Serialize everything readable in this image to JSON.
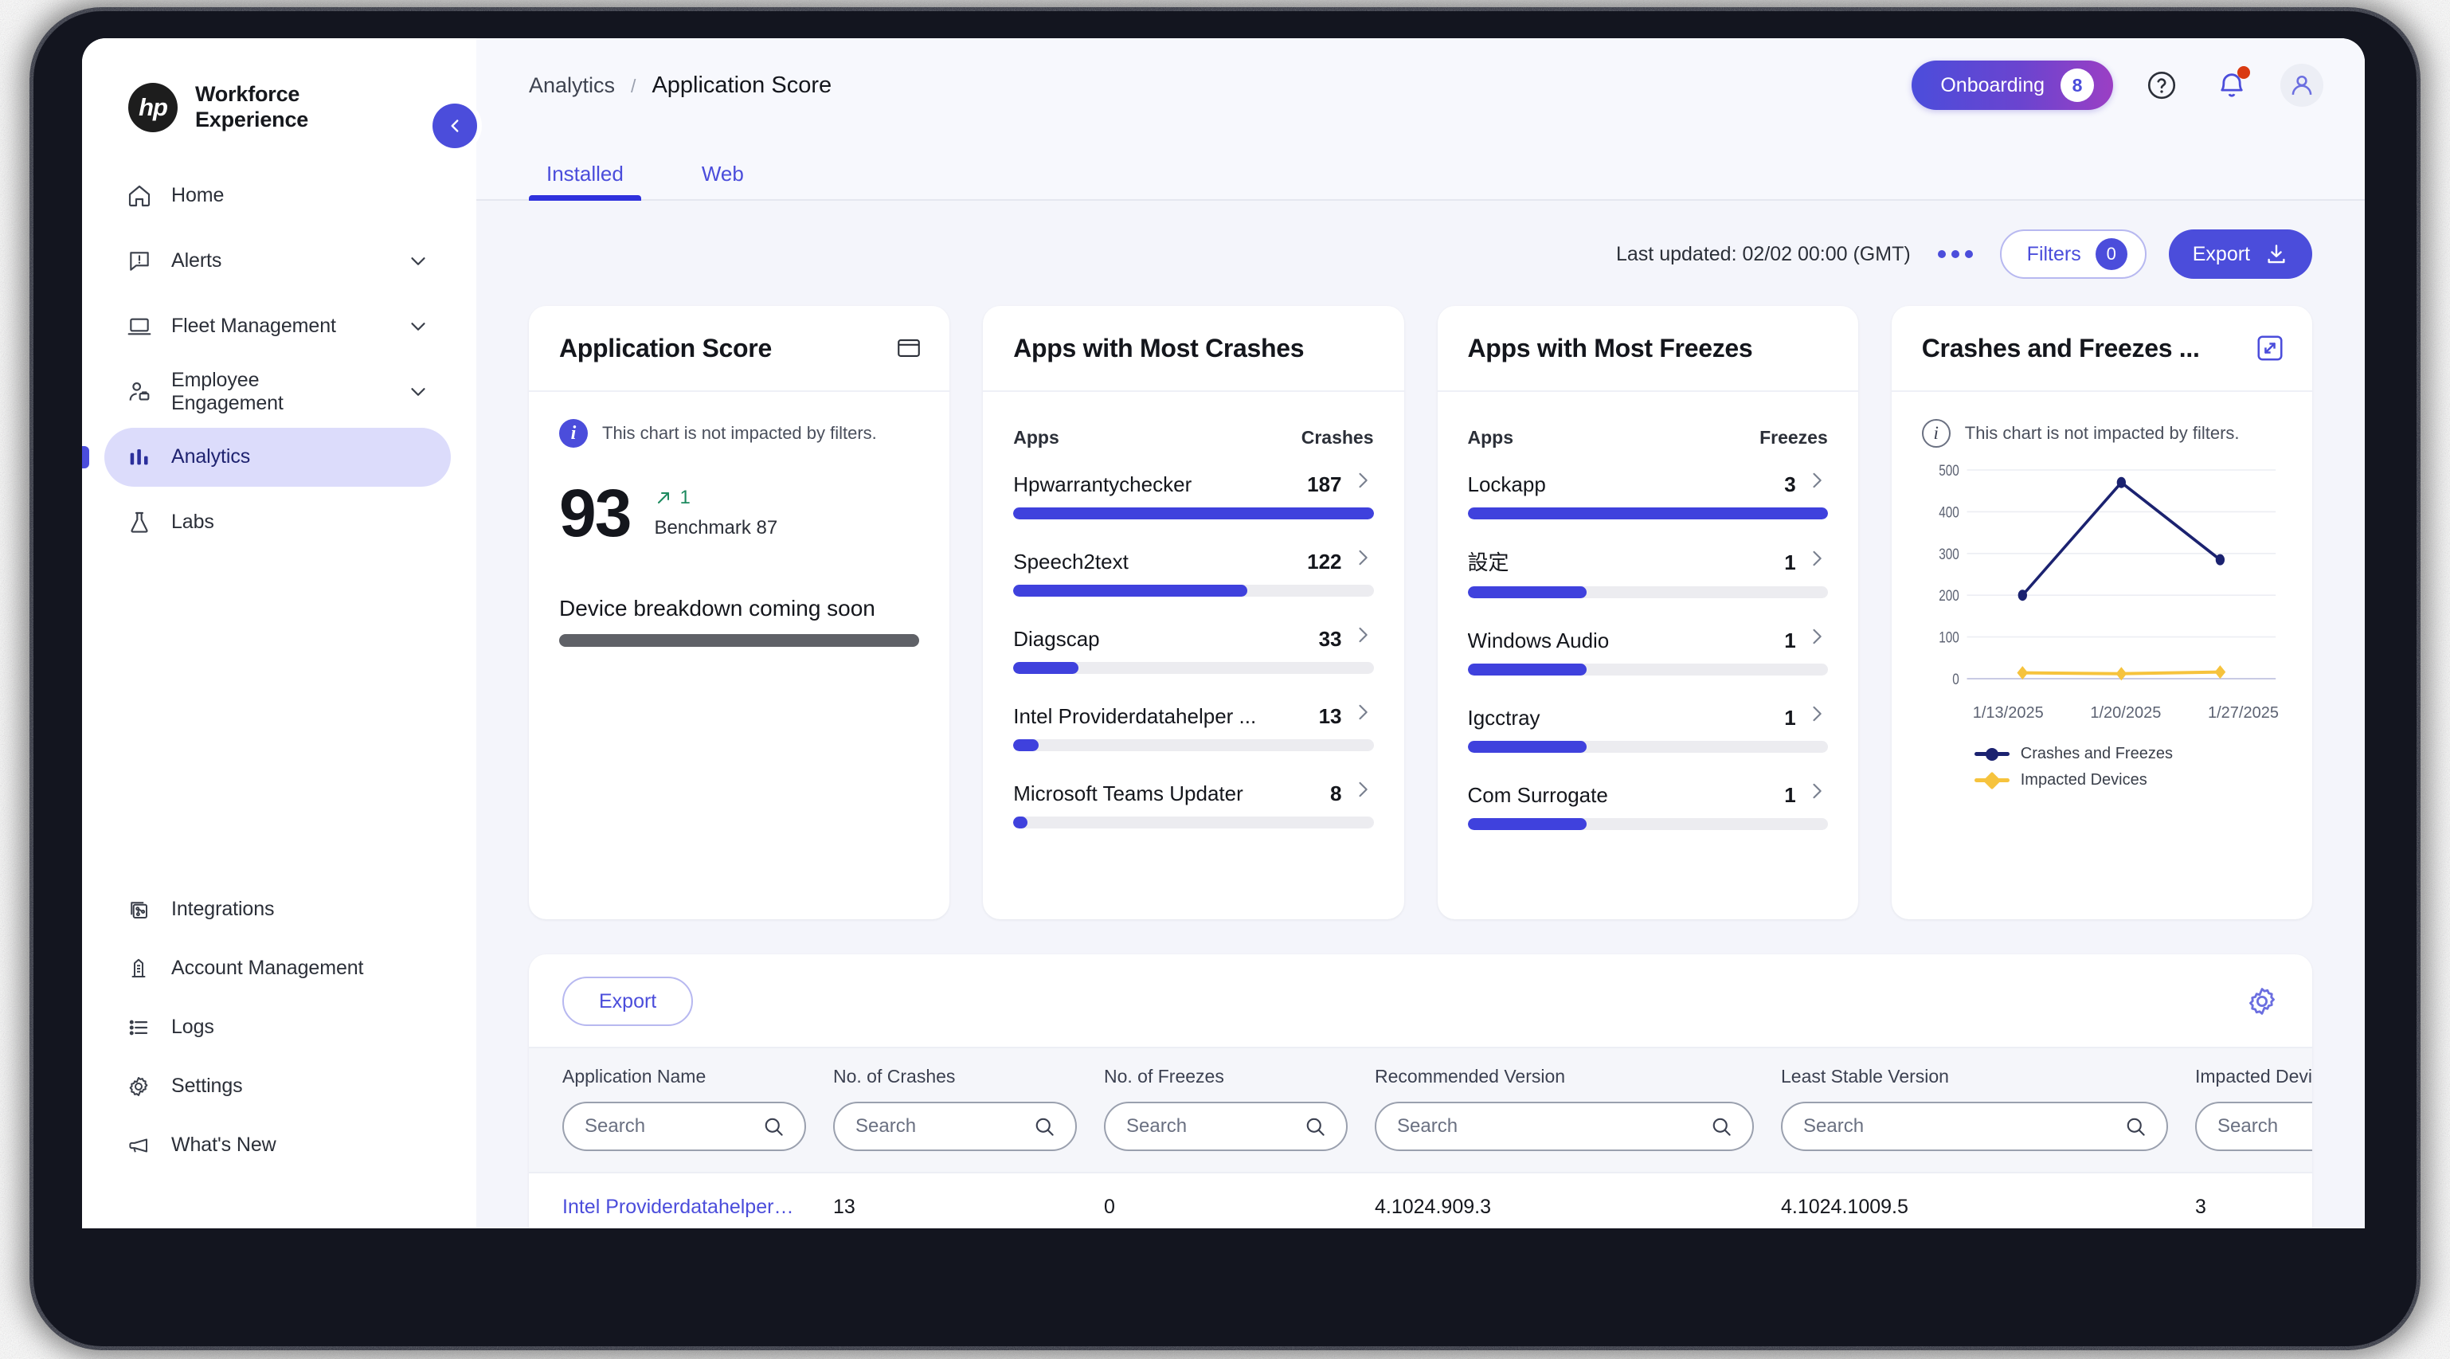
{
  "brand": {
    "logo_text": "hp",
    "name_line1": "Workforce",
    "name_line2": "Experience",
    "collapse_icon": "chevron-left-icon"
  },
  "sidebar": {
    "items": [
      {
        "label": "Home",
        "icon": "home-icon",
        "expandable": false,
        "active": false
      },
      {
        "label": "Alerts",
        "icon": "alert-icon",
        "expandable": true,
        "active": false
      },
      {
        "label": "Fleet Management",
        "icon": "laptop-icon",
        "expandable": true,
        "active": false
      },
      {
        "label": "Employee Engagement",
        "icon": "person-icon",
        "expandable": true,
        "active": false
      },
      {
        "label": "Analytics",
        "icon": "bar-chart-icon",
        "expandable": false,
        "active": true
      },
      {
        "label": "Labs",
        "icon": "flask-icon",
        "expandable": false,
        "active": false
      }
    ],
    "bottom_items": [
      {
        "label": "Integrations",
        "icon": "integrations-icon"
      },
      {
        "label": "Account Management",
        "icon": "building-icon"
      },
      {
        "label": "Logs",
        "icon": "list-icon"
      },
      {
        "label": "Settings",
        "icon": "gear-icon"
      },
      {
        "label": "What's New",
        "icon": "megaphone-icon"
      }
    ]
  },
  "topbar": {
    "breadcrumb_root": "Analytics",
    "breadcrumb_separator": "/",
    "breadcrumb_current": "Application Score",
    "onboarding_label": "Onboarding",
    "onboarding_count": "8",
    "help_icon": "question-circle-icon",
    "notifications_icon": "bell-icon",
    "avatar_icon": "user-icon"
  },
  "tabs": [
    {
      "label": "Installed",
      "active": true
    },
    {
      "label": "Web",
      "active": false
    }
  ],
  "toolbar": {
    "last_updated": "Last updated: 02/02 00:00 (GMT)",
    "more_icon": "more-horizontal-icon",
    "filters_label": "Filters",
    "filters_count": "0",
    "export_label": "Export",
    "export_icon": "download-icon"
  },
  "cards": {
    "application_score": {
      "title": "Application Score",
      "head_icon": "window-icon",
      "filter_note": "This chart is not impacted by filters.",
      "score": "93",
      "delta_icon": "arrow-up-right-icon",
      "delta": "1",
      "benchmark": "Benchmark 87",
      "breakdown_label": "Device breakdown coming soon"
    },
    "most_crashes": {
      "title": "Apps with Most Crashes",
      "col_apps": "Apps",
      "col_value": "Crashes",
      "rows": [
        {
          "name": "Hpwarrantychecker",
          "value": "187",
          "pct": 100
        },
        {
          "name": "Speech2text",
          "value": "122",
          "pct": 65
        },
        {
          "name": "Diagscap",
          "value": "33",
          "pct": 18
        },
        {
          "name": "Intel Providerdatahelper ...",
          "value": "13",
          "pct": 7
        },
        {
          "name": "Microsoft Teams Updater",
          "value": "8",
          "pct": 4
        }
      ]
    },
    "most_freezes": {
      "title": "Apps with Most Freezes",
      "col_apps": "Apps",
      "col_value": "Freezes",
      "rows": [
        {
          "name": "Lockapp",
          "value": "3",
          "pct": 100
        },
        {
          "name": "設定",
          "value": "1",
          "pct": 33
        },
        {
          "name": "Windows Audio",
          "value": "1",
          "pct": 33
        },
        {
          "name": "Igcctray",
          "value": "1",
          "pct": 33
        },
        {
          "name": "Com Surrogate",
          "value": "1",
          "pct": 33
        }
      ]
    },
    "crashes_freezes": {
      "title": "Crashes and Freezes ...",
      "head_icon": "expand-icon",
      "filter_note": "This chart is not impacted by filters."
    }
  },
  "chart_data": {
    "type": "line",
    "title": "Crashes and Freezes ...",
    "x": [
      "1/13/2025",
      "1/20/2025",
      "1/27/2025"
    ],
    "xlabel": "",
    "ylabel": "",
    "ylim": [
      0,
      500
    ],
    "yticks": [
      0,
      100,
      200,
      300,
      400,
      500
    ],
    "grid": true,
    "legend_position": "bottom-left",
    "series": [
      {
        "name": "Crashes and Freezes",
        "values": [
          200,
          470,
          285
        ],
        "color": "#1b2270",
        "marker": "circle"
      },
      {
        "name": "Impacted Devices",
        "values": [
          14,
          12,
          16
        ],
        "color": "#f6c33d",
        "marker": "diamond"
      }
    ]
  },
  "table": {
    "export_label": "Export",
    "gear_icon": "gear-icon",
    "columns": [
      {
        "label": "Application Name",
        "sortable": false
      },
      {
        "label": "No. of Crashes",
        "sortable": false
      },
      {
        "label": "No. of Freezes",
        "sortable": false
      },
      {
        "label": "Recommended Version",
        "sortable": false
      },
      {
        "label": "Least Stable Version",
        "sortable": false
      },
      {
        "label": "Impacted Devices",
        "sortable": true
      }
    ],
    "search_placeholder": "Search",
    "rows": [
      {
        "application_name": "Intel Providerdatahelper…",
        "crashes": "13",
        "freezes": "0",
        "recommended_version": "4.1024.909.3",
        "least_stable_version": "4.1024.1009.5",
        "impacted_devices": "3"
      }
    ]
  },
  "colors": {
    "accent": "#4b4ddb",
    "accent_dark": "#2f31dd",
    "sidebar_active_bg": "#dcdcfb",
    "chart_line": "#1b2270",
    "chart_line_secondary": "#f6c33d",
    "positive": "#1d8a5f",
    "notification": "#d93a12"
  }
}
